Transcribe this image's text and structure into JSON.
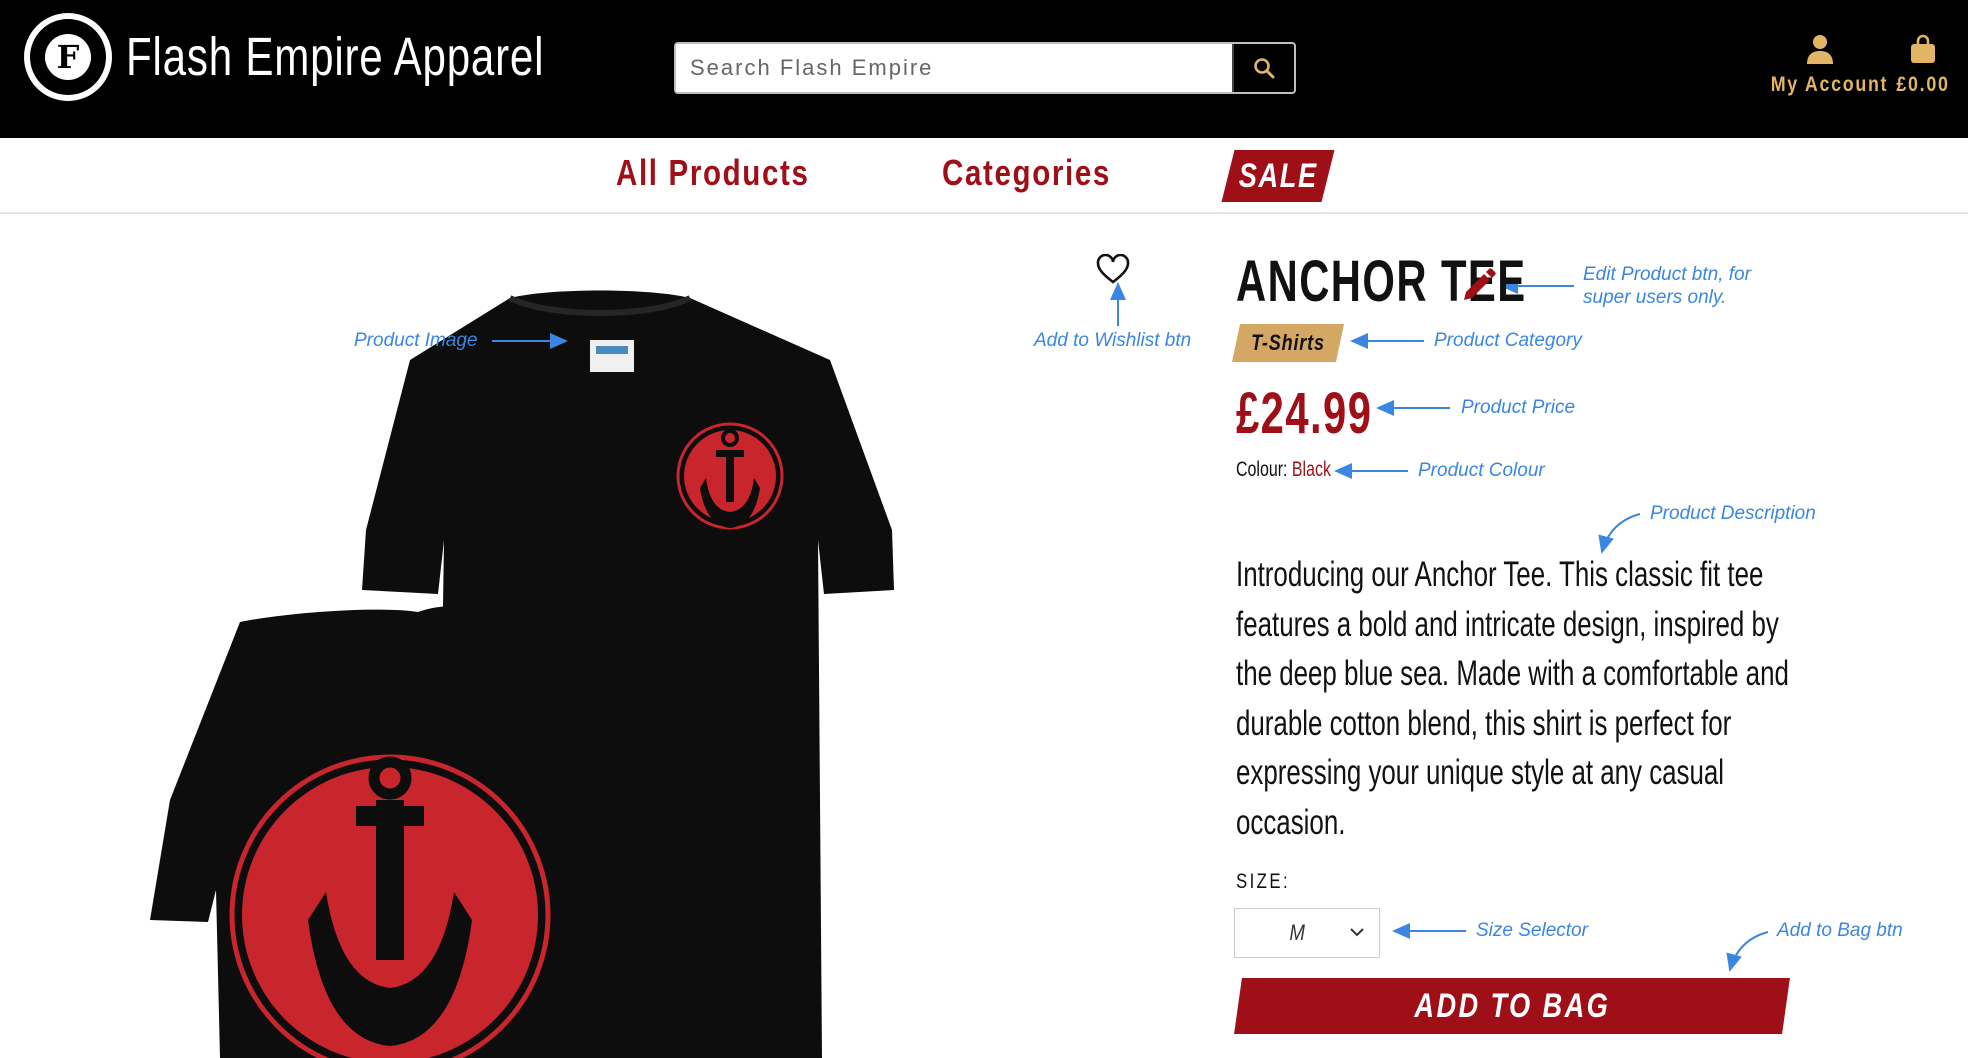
{
  "header": {
    "logo_letter": "F",
    "brand": "Flash Empire Apparel",
    "search_placeholder": "Search Flash Empire",
    "account_label": "My Account",
    "bag_total": "£0.00"
  },
  "nav": {
    "all_products": "All Products",
    "categories": "Categories",
    "sale": "SALE"
  },
  "product": {
    "name": "ANCHOR TEE",
    "category": "T-Shirts",
    "price": "£24.99",
    "colour_label": "Colour:",
    "colour_value": "Black",
    "description": "Introducing our Anchor Tee. This classic fit tee features a bold and intricate design, inspired by the deep blue sea. Made with a comfortable and durable cotton blend, this shirt is perfect for expressing your unique style at any casual occasion.",
    "size_label": "SIZE:",
    "size_selected": "M",
    "add_to_bag": "ADD TO BAG"
  },
  "annotations": {
    "product_image": "Product Image",
    "wishlist": "Add to Wishlist btn",
    "edit_product_1": "Edit Product btn, for",
    "edit_product_2": "super users only.",
    "category": "Product Category",
    "price": "Product Price",
    "colour": "Product Colour",
    "description": "Product Description",
    "size_selector": "Size Selector",
    "add_to_bag": "Add to Bag btn"
  },
  "colors": {
    "brand_red": "#9e0f17",
    "gold": "#e2b565",
    "annotation_blue": "#3b86e0",
    "category_tan": "#d4a765"
  },
  "icons": [
    "logo-icon",
    "search-icon",
    "user-icon",
    "bag-icon",
    "heart-icon",
    "pencil-icon",
    "chevron-down-icon"
  ]
}
